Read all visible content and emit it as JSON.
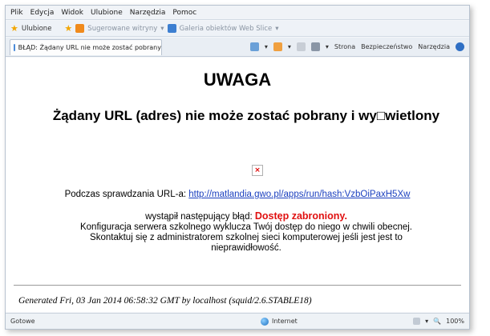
{
  "menu": [
    "Plik",
    "Edycja",
    "Widok",
    "Ulubione",
    "Narzędzia",
    "Pomoc"
  ],
  "favorites": {
    "label": "Ulubione",
    "items": [
      "Sugerowane witryny",
      "Galeria obiektów Web Slice"
    ]
  },
  "tab": {
    "title": "BŁĄD: Żądany URL nie może zostać pobrany"
  },
  "command_bar": {
    "page": "Strona",
    "security": "Bezpieczeństwo",
    "tools": "Narzędzia"
  },
  "page": {
    "heading": "UWAGA",
    "message": "Żądany URL (adres) nie może zostać pobrany i wy□wietlony",
    "check_prefix": "Podczas sprawdzania URL-a:",
    "url": "http://matlandia.gwo.pl/apps/run/hash:VzbOiPaxH5Xw",
    "error_prefix": "wystąpił następujący błąd:",
    "error_title": "Dostęp zabroniony.",
    "error_line1": "Konfiguracja serwera szkolnego wyklucza Twój dostęp do niego w chwili obecnej.",
    "error_line2": "Skontaktuj się z administratorem szkolnej sieci komputerowej jeśli jest jest to nieprawidłowość.",
    "generated": "Generated Fri, 03 Jan 2014 06:58:32 GMT by localhost (squid/2.6.STABLE18)"
  },
  "status": {
    "left": "Gotowe",
    "zone": "Internet",
    "zoom": "100%"
  },
  "colors": {
    "link": "#1a3fbf",
    "error": "#e01010"
  }
}
